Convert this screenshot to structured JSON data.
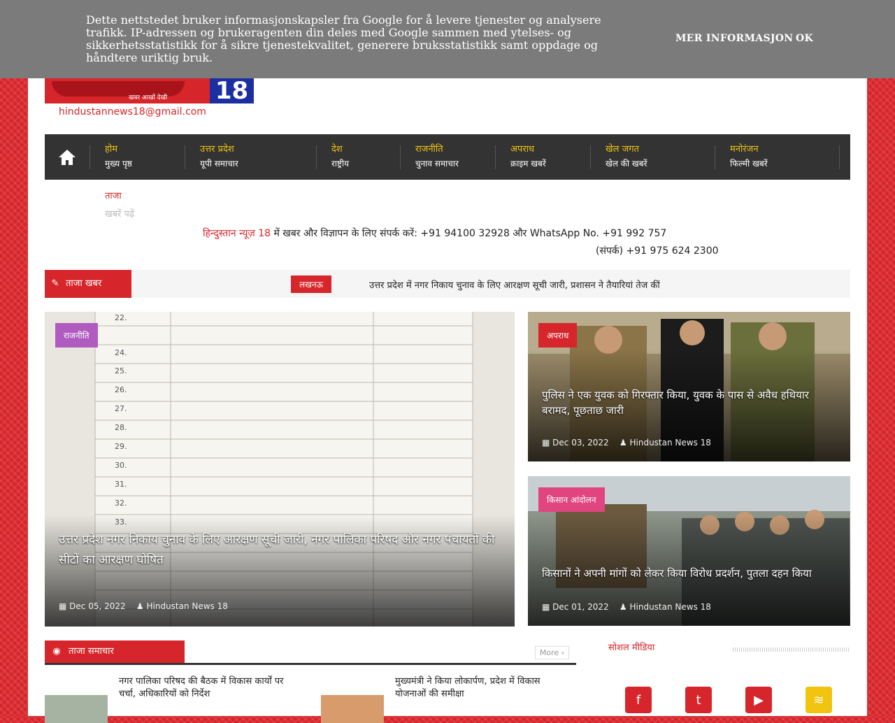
{
  "cookie": {
    "text": "Dette nettstedet bruker informasjonskapsler fra Google for å levere tjenester og analysere trafikk. IP-adressen og brukeragenten din deles med Google sammen med ytelses- og sikkerhetsstatistikk for å sikre tjenestekvalitet, generere bruksstatistikk samt oppdage og håndtere uriktig bruk.",
    "more_label": "MER INFORMASJON",
    "ok_label": "OK"
  },
  "header": {
    "logo_number": "18",
    "logo_tagline": "खबर आखों देखी",
    "email": "hindustannews18@gmail.com"
  },
  "nav": {
    "items": [
      {
        "line1": "होम",
        "line2": "मुख्य पृष्ठ"
      },
      {
        "line1": "उत्तर प्रदेश",
        "line2": "यूपी समाचार"
      },
      {
        "line1": "देश",
        "line2": "राष्ट्रीय"
      },
      {
        "line1": "राजनीति",
        "line2": "चुनाव समाचार"
      },
      {
        "line1": "अपराध",
        "line2": "क्राइम खबरें"
      },
      {
        "line1": "खेल जगत",
        "line2": "खेल की खबरें"
      },
      {
        "line1": "मनोरंजन",
        "line2": "फिल्मी खबरें"
      }
    ]
  },
  "subnav": {
    "line1": "ताजा",
    "line2": "खबरें पढ़ें"
  },
  "contact": {
    "brand_prefix": "हिन्दुस्तान न्यूज़ ",
    "brand_number": "18",
    "text1": " में खबर और विज्ञापन के लिए संपर्क करें: +91 94100 32928 और WhatsApp No. +91 992 757",
    "text2": "(संपर्क) +91 975 624 2300"
  },
  "breaking": {
    "label": "ताजा खबर",
    "tag": "लखनऊ",
    "text": "उत्तर प्रदेश में नगर निकाय चुनाव के लिए आरक्षण सूची जारी, प्रशासन ने तैयारियां तेज कीं"
  },
  "hero": {
    "main": {
      "category": "राजनीति",
      "title": "उत्तर प्रदेश नगर निकाय चुनाव के लिए आरक्षण सूची जारी, नगर पालिका परिषद और नगर पंचायतों की सीटों का आरक्षण घोषित",
      "date": "Dec 05, 2022",
      "author": "Hindustan News 18"
    },
    "side1": {
      "category": "अपराध",
      "title": "पुलिस ने एक युवक को गिरफ्तार किया, युवक के पास से अवैध हथियार बरामद, पूछताछ जारी",
      "date": "Dec 03, 2022",
      "author": "Hindustan News 18"
    },
    "side2": {
      "category": "किसान आंदोलन",
      "title": "किसानों ने अपनी मांगों को लेकर किया विरोध प्रदर्शन, पुतला दहन किया",
      "date": "Dec 01, 2022",
      "author": "Hindustan News 18"
    }
  },
  "section": {
    "label": "ताजा समाचार",
    "more_label": "More",
    "social_label": "सोशल मीडिया",
    "posts": [
      {
        "title": "नगर पालिका परिषद की बैठक में विकास कार्यों पर चर्चा, अधिकारियों को निर्देश"
      },
      {
        "title": "मुख्यमंत्री ने किया लोकार्पण, प्रदेश में विकास योजनाओं की समीक्षा"
      }
    ]
  },
  "colors": {
    "accent": "#d7262b",
    "nav_bg": "#333333",
    "nav_text": "#f1c40f",
    "cookie_bg": "#7b7b7b",
    "facebook": "#d7262b",
    "twitter": "#d7262b"
  },
  "icons": {
    "home": "home-icon",
    "social": [
      "facebook-icon",
      "twitter-icon",
      "youtube-icon",
      "rss-icon"
    ]
  }
}
